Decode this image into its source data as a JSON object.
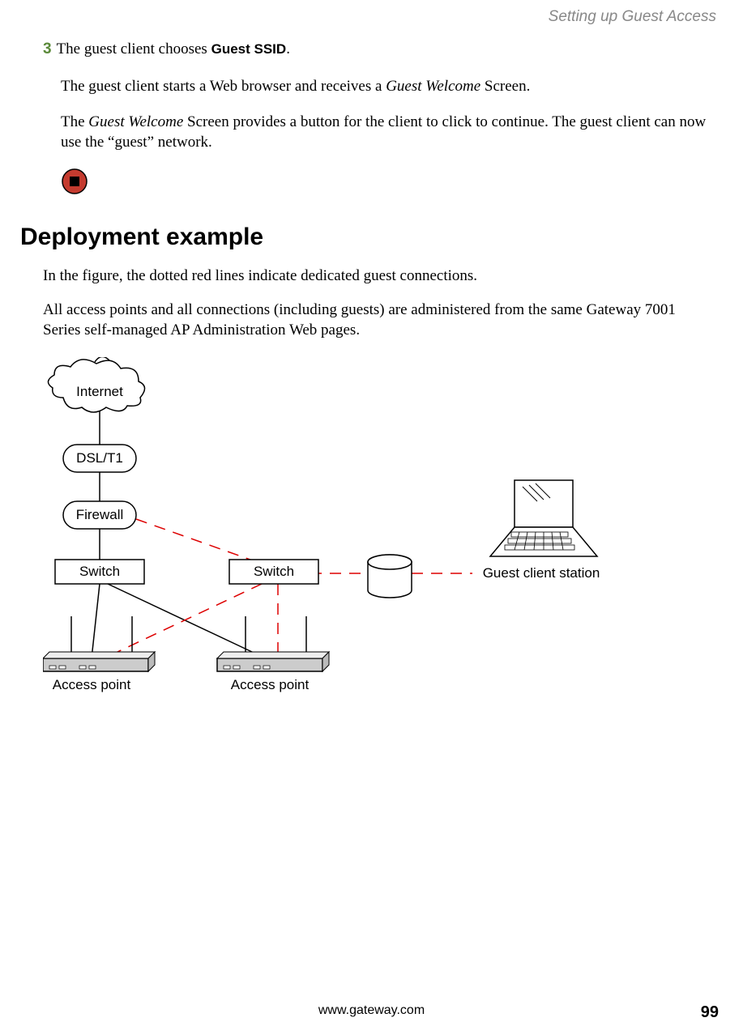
{
  "header": {
    "section_title": "Setting up Guest Access"
  },
  "step3": {
    "number": "3",
    "text_before": "The guest client chooses ",
    "bold": "Guest SSID",
    "text_after": "."
  },
  "para1": {
    "t1": "The guest client starts a Web browser and receives a ",
    "italic1": "Guest Welcome",
    "t2": " Screen."
  },
  "para2": {
    "t1": "The ",
    "italic1": "Guest Welcome",
    "t2": " Screen provides a button for the client to click to continue. The guest client can now use the “guest” network."
  },
  "heading": "Deployment example",
  "intro1": "In the figure, the dotted red lines indicate dedicated guest connections.",
  "intro2": "All access points and all connections (including guests) are administered from the same Gateway 7001 Series self-managed AP Administration Web pages.",
  "diagram": {
    "internet": "Internet",
    "dsl": "DSL/T1",
    "firewall": "Firewall",
    "switch1": "Switch",
    "switch2": "Switch",
    "ap1": "Access point",
    "ap2": "Access point",
    "guest": "Guest client station"
  },
  "footer": {
    "url": "www.gateway.com",
    "page": "99"
  }
}
